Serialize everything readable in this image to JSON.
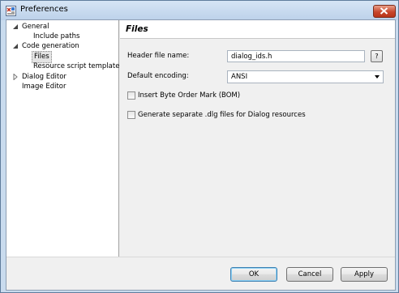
{
  "window": {
    "title": "Preferences",
    "icon": "preferences-app-icon",
    "close_icon": "close-icon"
  },
  "tree": {
    "items": [
      {
        "label": "General",
        "level": 0,
        "state": "expanded"
      },
      {
        "label": "Include paths",
        "level": 1,
        "state": "leaf"
      },
      {
        "label": "Code generation",
        "level": 0,
        "state": "expanded"
      },
      {
        "label": "Files",
        "level": 1,
        "state": "leaf",
        "selected": true
      },
      {
        "label": "Resource script template",
        "level": 1,
        "state": "leaf"
      },
      {
        "label": "Dialog Editor",
        "level": 0,
        "state": "collapsed"
      },
      {
        "label": "Image Editor",
        "level": 0,
        "state": "leaf"
      }
    ]
  },
  "panel": {
    "title": "Files",
    "header_file": {
      "label": "Header file name:",
      "value": "dialog_ids.h",
      "help_label": "?"
    },
    "encoding": {
      "label": "Default encoding:",
      "value": "ANSI"
    },
    "bom_checkbox": {
      "label": "Insert Byte Order Mark (BOM)",
      "checked": false
    },
    "dlg_checkbox": {
      "label": "Generate separate .dlg files for Dialog resources",
      "checked": false
    }
  },
  "buttons": {
    "ok": "OK",
    "cancel": "Cancel",
    "apply": "Apply"
  },
  "colors": {
    "frame": "#c9dbee",
    "selection": "#e4e4e4",
    "default_button_border": "#3c7fb1"
  }
}
